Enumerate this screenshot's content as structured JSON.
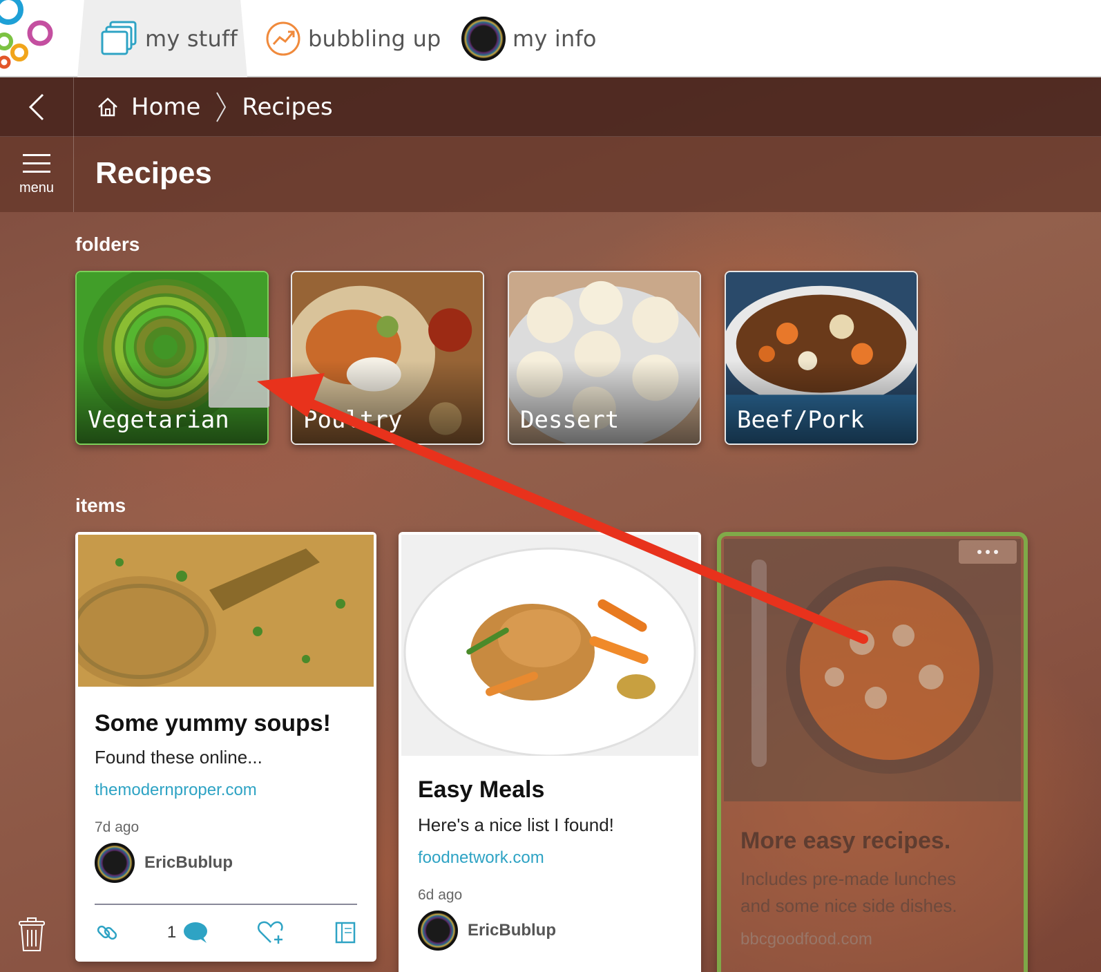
{
  "nav": {
    "tabs": [
      {
        "label": "my stuff",
        "icon": "folders-icon",
        "active": true
      },
      {
        "label": "bubbling up",
        "icon": "trending-icon",
        "active": false
      },
      {
        "label": "my info",
        "icon": "avatar-icon",
        "active": false
      }
    ]
  },
  "breadcrumb": {
    "home": "Home",
    "current": "Recipes"
  },
  "menu": {
    "label": "menu"
  },
  "page": {
    "title": "Recipes"
  },
  "sections": {
    "folders": "folders",
    "items": "items"
  },
  "folders": [
    {
      "label": "Vegetarian",
      "state": "drop-target"
    },
    {
      "label": "Poultry"
    },
    {
      "label": "Dessert"
    },
    {
      "label": "Beef/Pork"
    }
  ],
  "items": [
    {
      "title": "Some yummy soups!",
      "desc": "Found these online...",
      "link": "themodernproper.com",
      "time": "7d ago",
      "user": "EricBublup",
      "comments": "1"
    },
    {
      "title": "Easy Meals",
      "desc": "Here's a nice list I found!",
      "link": "foodnetwork.com",
      "time": "6d ago",
      "user": "EricBublup"
    },
    {
      "title": "More easy recipes.",
      "desc_line1": "Includes pre-made lunches",
      "desc_line2": "and some nice side dishes.",
      "link": "bbcgoodfood.com",
      "state": "dragging"
    }
  ],
  "colors": {
    "accent": "#2ea3c4",
    "drop_green": "#7cd05a",
    "drag_border": "#7fb14a",
    "arrow": "#e8321c",
    "header_bg": "#5a2f25"
  }
}
